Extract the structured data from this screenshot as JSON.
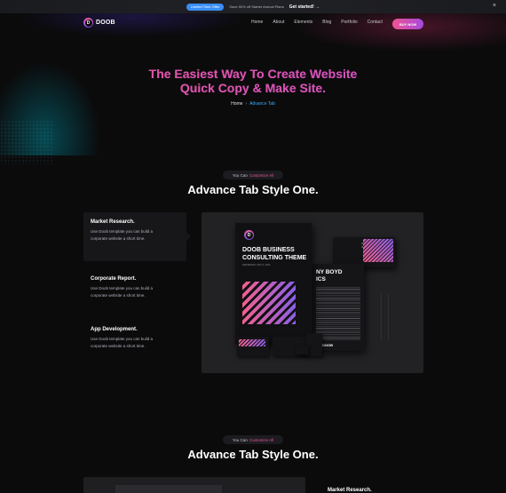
{
  "topbar": {
    "tag": "Limited Time Offer",
    "text": "Save 50% off Starter Annual Plans",
    "cta": "Get started! →",
    "close": "×"
  },
  "header": {
    "logo_mark": "D",
    "logo_text": "DOOB",
    "nav": [
      "Home",
      "About",
      "Elements",
      "Blog",
      "Portfolio",
      "Contact"
    ],
    "buy": "BUY NOW"
  },
  "hero": {
    "title_line1": "The Easiest Way To Create Website",
    "title_line2": "Quick Copy & Make Site.",
    "breadcrumb": {
      "home": "Home",
      "sep": "›",
      "current": "Advance Tab"
    }
  },
  "section1": {
    "badge_muted": "You Can",
    "badge_highlight": "Customize All",
    "title": "Advance Tab Style One."
  },
  "tabs": [
    {
      "title": "Market Research.",
      "desc_line1": "Use Doob template you can build a",
      "desc_line2": "corporate website a short time."
    },
    {
      "title": "Corporate Report.",
      "desc_line1": "Use Doob template you can build a",
      "desc_line2": "corporate website a short time."
    },
    {
      "title": "App Development.",
      "desc_line1": "Use Doob template you can build a",
      "desc_line2": "corporate website a short time."
    }
  ],
  "mockup": {
    "book_logo": "D",
    "book_title": "DOOB BUSINESS CONSULTING THEME",
    "book_sub": "WEDNESDAY, MAY 6, 2020",
    "doc_title_line1": "NY BOYD",
    "doc_title_line2": "ICS",
    "doc_brand": "DOOB",
    "card_text_line1": "MODERN BRANDING",
    "card_text_line2": "IDENTITY MOCKUP"
  },
  "section2": {
    "badge_muted": "You Can",
    "badge_highlight": "Customize All",
    "title": "Advance Tab Style One."
  },
  "peek": {
    "label": "Market Research."
  },
  "colors": {
    "accent_pink": "#e9559a",
    "accent_purple": "#a548e0",
    "link_blue": "#3fa9f5",
    "bg": "#0b0b0c"
  }
}
